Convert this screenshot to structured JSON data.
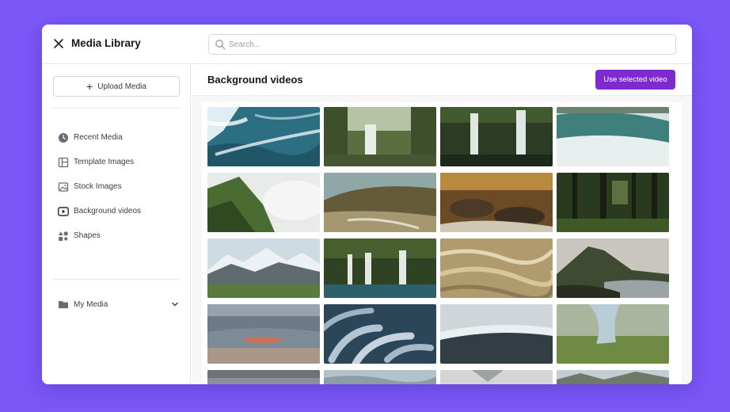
{
  "header": {
    "title": "Media Library",
    "search_placeholder": "Search...",
    "search_value": ""
  },
  "sidebar": {
    "upload_label": "Upload Media",
    "items": [
      {
        "label": "Recent Media",
        "icon": "clock-icon"
      },
      {
        "label": "Template Images",
        "icon": "template-icon"
      },
      {
        "label": "Stock Images",
        "icon": "image-icon"
      },
      {
        "label": "Background videos",
        "icon": "play-icon"
      },
      {
        "label": "Shapes",
        "icon": "shapes-icon"
      }
    ],
    "my_media_label": "My Media"
  },
  "main": {
    "title": "Background videos",
    "use_button_label": "Use selected video"
  },
  "colors": {
    "background": "#7b57f7",
    "accent": "#7e2ad1"
  },
  "thumbnails": [
    {
      "scene": "ocean-waves-aerial"
    },
    {
      "scene": "forest-waterfall"
    },
    {
      "scene": "twin-waterfalls"
    },
    {
      "scene": "large-waterfall"
    },
    {
      "scene": "misty-mountain-ridge"
    },
    {
      "scene": "desert-hill-stream"
    },
    {
      "scene": "autumn-rocky-stream"
    },
    {
      "scene": "dark-forest"
    },
    {
      "scene": "snowy-mountains"
    },
    {
      "scene": "jungle-waterfalls"
    },
    {
      "scene": "wheat-field"
    },
    {
      "scene": "volcano-coast"
    },
    {
      "scene": "sunset-beach"
    },
    {
      "scene": "coral-tentacles"
    },
    {
      "scene": "waterfall-edge"
    },
    {
      "scene": "grass-field-dress"
    },
    {
      "scene": "cloudy-hills"
    },
    {
      "scene": "misty-valley"
    },
    {
      "scene": "pale-landscape"
    },
    {
      "scene": "mountain-horizon"
    }
  ]
}
